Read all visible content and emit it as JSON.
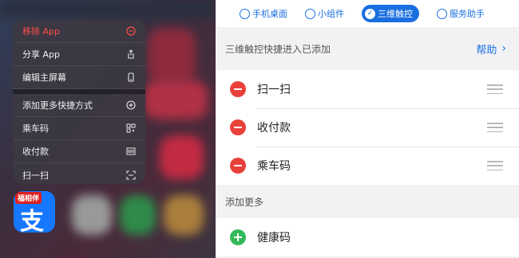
{
  "context_menu": {
    "items": [
      {
        "label": "移除 App",
        "icon": "minus-circle-icon",
        "danger": true
      },
      {
        "label": "分享 App",
        "icon": "share-icon"
      },
      {
        "label": "编辑主屏幕",
        "icon": "phone-icon"
      },
      {
        "label": "添加更多快捷方式",
        "icon": "plus-circle-icon"
      },
      {
        "label": "乘车码",
        "icon": "qr-code-icon"
      },
      {
        "label": "收付款",
        "icon": "barcode-icon"
      },
      {
        "label": "扫一扫",
        "icon": "scan-icon"
      }
    ]
  },
  "app_icon": {
    "badge": "福相伴",
    "glyph": "支",
    "color": "#1677ff"
  },
  "tabs": [
    {
      "label": "手机桌面",
      "active": false
    },
    {
      "label": "小组件",
      "active": false
    },
    {
      "label": "三维触控",
      "active": true
    },
    {
      "label": "服务助手",
      "active": false
    }
  ],
  "settings": {
    "added_title": "三维触控快捷进入已添加",
    "help_label": "帮助",
    "added_items": [
      "扫一扫",
      "收付款",
      "乘车码"
    ],
    "more_title": "添加更多",
    "more_items": [
      "健康码"
    ]
  },
  "colors": {
    "accent": "#1a6fe0",
    "remove": "#e8413a",
    "add": "#33b95a",
    "danger_text": "#ff4d4d"
  }
}
